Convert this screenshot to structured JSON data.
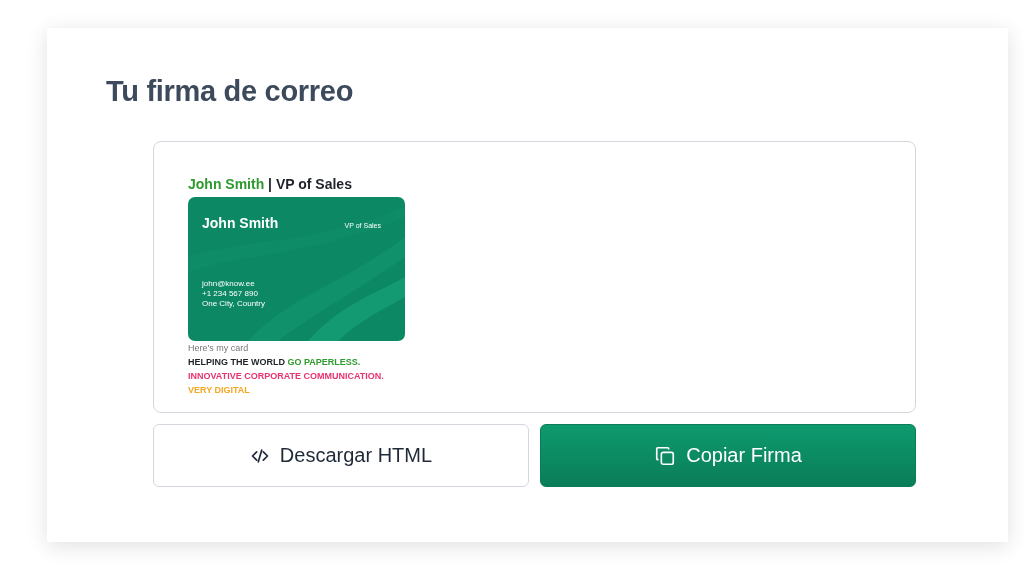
{
  "title": "Tu firma de correo",
  "signature": {
    "heading": [
      {
        "text": "John Smith",
        "color": "#2e9a2e"
      },
      {
        "text": " | VP of Sales",
        "color": "#1f2329"
      }
    ],
    "card": {
      "name": "John Smith",
      "role": "VP of Sales",
      "lines": [
        "john@know.ee",
        "+1 234 567 890",
        "One City, Country"
      ]
    },
    "caption": "Here's my card",
    "taglines": [
      [
        {
          "text": "HELPING THE WORLD ",
          "color": "#1f2329"
        },
        {
          "text": "GO PAPERLESS.",
          "color": "#2e9a2e"
        }
      ],
      [
        {
          "text": "INNOVATIVE CORPORATE COMMUNICATION.",
          "color": "#e8336d"
        }
      ],
      [
        {
          "text": "VERY DIGITAL",
          "color": "#f5a623"
        }
      ]
    ]
  },
  "buttons": [
    {
      "kind": "code",
      "label": "Descargar HTML"
    },
    {
      "kind": "copy",
      "label": "Copiar Firma"
    }
  ]
}
